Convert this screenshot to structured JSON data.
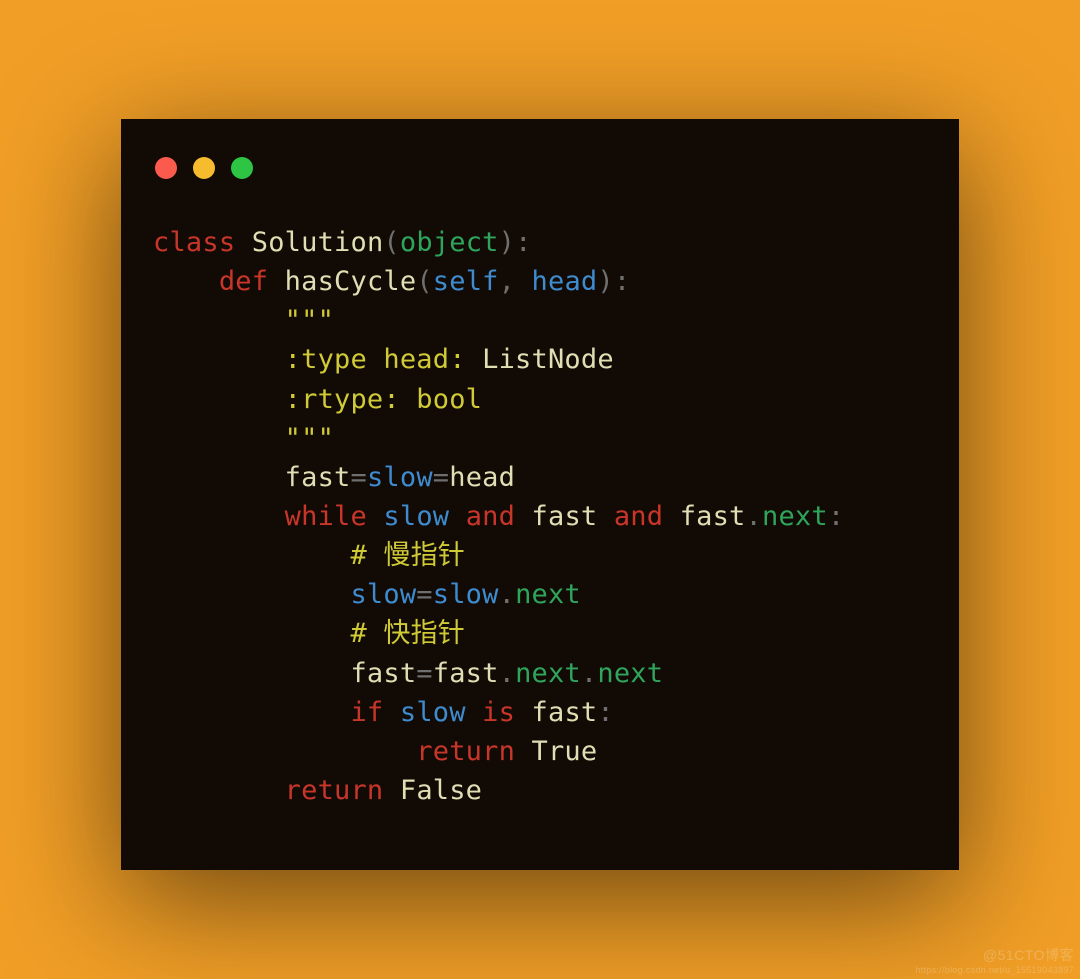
{
  "window": {
    "dots": {
      "red": "#fa5b4c",
      "yellow": "#f7bc2e",
      "green": "#2ec444"
    }
  },
  "code": {
    "lines": [
      [
        {
          "c": "tok-kw",
          "t": "class"
        },
        {
          "c": "tok-op",
          "t": " "
        },
        {
          "c": "tok-name",
          "t": "Solution"
        },
        {
          "c": "tok-op",
          "t": "("
        },
        {
          "c": "tok-func",
          "t": "object"
        },
        {
          "c": "tok-op",
          "t": "):"
        }
      ],
      [
        {
          "c": "tok-op",
          "t": "    "
        },
        {
          "c": "tok-kw",
          "t": "def"
        },
        {
          "c": "tok-op",
          "t": " "
        },
        {
          "c": "tok-name",
          "t": "hasCycle"
        },
        {
          "c": "tok-op",
          "t": "("
        },
        {
          "c": "tok-param",
          "t": "self"
        },
        {
          "c": "tok-op",
          "t": ", "
        },
        {
          "c": "tok-param",
          "t": "head"
        },
        {
          "c": "tok-op",
          "t": "):"
        }
      ],
      [
        {
          "c": "tok-op",
          "t": "        "
        },
        {
          "c": "tok-str",
          "t": "\"\"\""
        }
      ],
      [
        {
          "c": "tok-op",
          "t": "        "
        },
        {
          "c": "tok-str",
          "t": ":type head: "
        },
        {
          "c": "tok-name",
          "t": "ListNode"
        }
      ],
      [
        {
          "c": "tok-op",
          "t": "        "
        },
        {
          "c": "tok-str",
          "t": ":rtype: bool"
        }
      ],
      [
        {
          "c": "tok-op",
          "t": "        "
        },
        {
          "c": "tok-str",
          "t": "\"\"\""
        }
      ],
      [
        {
          "c": "tok-op",
          "t": "        "
        },
        {
          "c": "tok-name",
          "t": "fast"
        },
        {
          "c": "tok-op",
          "t": "="
        },
        {
          "c": "tok-param",
          "t": "slow"
        },
        {
          "c": "tok-op",
          "t": "="
        },
        {
          "c": "tok-name",
          "t": "head"
        }
      ],
      [
        {
          "c": "tok-op",
          "t": "        "
        },
        {
          "c": "tok-kw",
          "t": "while"
        },
        {
          "c": "tok-op",
          "t": " "
        },
        {
          "c": "tok-param",
          "t": "slow"
        },
        {
          "c": "tok-op",
          "t": " "
        },
        {
          "c": "tok-kw",
          "t": "and"
        },
        {
          "c": "tok-op",
          "t": " "
        },
        {
          "c": "tok-name",
          "t": "fast"
        },
        {
          "c": "tok-op",
          "t": " "
        },
        {
          "c": "tok-kw",
          "t": "and"
        },
        {
          "c": "tok-op",
          "t": " "
        },
        {
          "c": "tok-name",
          "t": "fast"
        },
        {
          "c": "tok-op",
          "t": "."
        },
        {
          "c": "tok-func",
          "t": "next"
        },
        {
          "c": "tok-op",
          "t": ":"
        }
      ],
      [
        {
          "c": "tok-op",
          "t": "            "
        },
        {
          "c": "tok-str",
          "t": "# 慢指针"
        }
      ],
      [
        {
          "c": "tok-op",
          "t": "            "
        },
        {
          "c": "tok-param",
          "t": "slow"
        },
        {
          "c": "tok-op",
          "t": "="
        },
        {
          "c": "tok-param",
          "t": "slow"
        },
        {
          "c": "tok-op",
          "t": "."
        },
        {
          "c": "tok-func",
          "t": "next"
        }
      ],
      [
        {
          "c": "tok-op",
          "t": "            "
        },
        {
          "c": "tok-str",
          "t": "# 快指针"
        }
      ],
      [
        {
          "c": "tok-op",
          "t": "            "
        },
        {
          "c": "tok-name",
          "t": "fast"
        },
        {
          "c": "tok-op",
          "t": "="
        },
        {
          "c": "tok-name",
          "t": "fast"
        },
        {
          "c": "tok-op",
          "t": "."
        },
        {
          "c": "tok-func",
          "t": "next"
        },
        {
          "c": "tok-op",
          "t": "."
        },
        {
          "c": "tok-func",
          "t": "next"
        }
      ],
      [
        {
          "c": "tok-op",
          "t": "            "
        },
        {
          "c": "tok-kw",
          "t": "if"
        },
        {
          "c": "tok-op",
          "t": " "
        },
        {
          "c": "tok-param",
          "t": "slow"
        },
        {
          "c": "tok-op",
          "t": " "
        },
        {
          "c": "tok-kw",
          "t": "is"
        },
        {
          "c": "tok-op",
          "t": " "
        },
        {
          "c": "tok-name",
          "t": "fast"
        },
        {
          "c": "tok-op",
          "t": ":"
        }
      ],
      [
        {
          "c": "tok-op",
          "t": "                "
        },
        {
          "c": "tok-kw",
          "t": "return"
        },
        {
          "c": "tok-op",
          "t": " "
        },
        {
          "c": "tok-name",
          "t": "True"
        }
      ],
      [
        {
          "c": "tok-op",
          "t": "        "
        },
        {
          "c": "tok-kw",
          "t": "return"
        },
        {
          "c": "tok-op",
          "t": " "
        },
        {
          "c": "tok-name",
          "t": "False"
        }
      ]
    ]
  },
  "watermark": {
    "line1": "@51CTO博客",
    "line2": "https://blog.csdn.net/u_15519043897"
  }
}
